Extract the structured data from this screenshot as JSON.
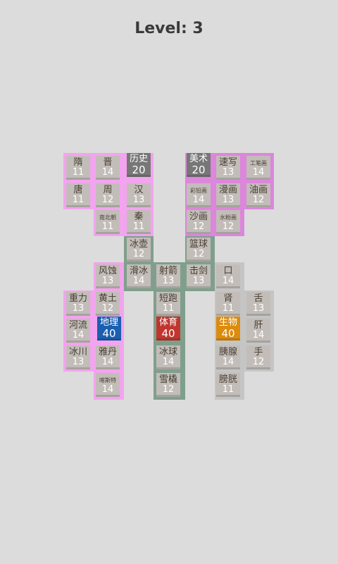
{
  "header": {
    "level_text": "Level: 3"
  },
  "colors": {
    "pink": "#f2a4ee",
    "magenta": "#dc86dc",
    "green": "#7f9f8c",
    "grey": "#c5c5c5",
    "tile": "#c2bdb8",
    "history_head": "#777777",
    "art_head": "#777777",
    "geo_head": "#1a5fb0",
    "sport_head": "#c0362f",
    "bio_head": "#dc8b0c"
  },
  "tiles": [
    {
      "id": "sui",
      "name": "隋",
      "value": "11"
    },
    {
      "id": "jin",
      "name": "晋",
      "value": "14"
    },
    {
      "id": "history",
      "name": "历史",
      "value": "20",
      "head": true
    },
    {
      "id": "tang",
      "name": "唐",
      "value": "11"
    },
    {
      "id": "zhou",
      "name": "周",
      "value": "12"
    },
    {
      "id": "han",
      "name": "汉",
      "value": "13"
    },
    {
      "id": "nanbeichao",
      "name": "南北朝",
      "value": "11",
      "small": true
    },
    {
      "id": "qin",
      "name": "秦",
      "value": "11"
    },
    {
      "id": "art",
      "name": "美术",
      "value": "20",
      "head": true
    },
    {
      "id": "suxie",
      "name": "速写",
      "value": "13"
    },
    {
      "id": "gongbi",
      "name": "工笔画",
      "value": "14",
      "small": true
    },
    {
      "id": "caiqian",
      "name": "彩铅画",
      "value": "14",
      "small": true
    },
    {
      "id": "manhua",
      "name": "漫画",
      "value": "13"
    },
    {
      "id": "youhua",
      "name": "油画",
      "value": "12"
    },
    {
      "id": "shahua",
      "name": "沙画",
      "value": "12"
    },
    {
      "id": "shuifen",
      "name": "水粉画",
      "value": "12",
      "small": true
    },
    {
      "id": "bingpo",
      "name": "冰壶",
      "value": "12"
    },
    {
      "id": "lanqiu",
      "name": "篮球",
      "value": "12"
    },
    {
      "id": "fengshi",
      "name": "风蚀",
      "value": "13"
    },
    {
      "id": "huabing",
      "name": "滑冰",
      "value": "14"
    },
    {
      "id": "shejian",
      "name": "射箭",
      "value": "13"
    },
    {
      "id": "jijian",
      "name": "击剑",
      "value": "13"
    },
    {
      "id": "kou",
      "name": "口",
      "value": "14"
    },
    {
      "id": "zhongli",
      "name": "重力",
      "value": "13"
    },
    {
      "id": "huangtu",
      "name": "黄土",
      "value": "12"
    },
    {
      "id": "duanpao",
      "name": "短跑",
      "value": "11"
    },
    {
      "id": "shen",
      "name": "肾",
      "value": "11"
    },
    {
      "id": "she",
      "name": "舌",
      "value": "13"
    },
    {
      "id": "heliu",
      "name": "河流",
      "value": "14"
    },
    {
      "id": "geography",
      "name": "地理",
      "value": "40",
      "head": true
    },
    {
      "id": "sport",
      "name": "体育",
      "value": "40",
      "head": true
    },
    {
      "id": "biology",
      "name": "生物",
      "value": "40",
      "head": true
    },
    {
      "id": "gan",
      "name": "肝",
      "value": "14"
    },
    {
      "id": "bingchuan",
      "name": "冰川",
      "value": "13"
    },
    {
      "id": "yadan",
      "name": "雅丹",
      "value": "14"
    },
    {
      "id": "bingqiu",
      "name": "冰球",
      "value": "14"
    },
    {
      "id": "yixian",
      "name": "胰腺",
      "value": "14"
    },
    {
      "id": "shou",
      "name": "手",
      "value": "12"
    },
    {
      "id": "kasite",
      "name": "喀斯特",
      "value": "14",
      "small": true
    },
    {
      "id": "xueqiao",
      "name": "雪橇",
      "value": "12"
    },
    {
      "id": "pangguang",
      "name": "膀胱",
      "value": "11"
    }
  ]
}
